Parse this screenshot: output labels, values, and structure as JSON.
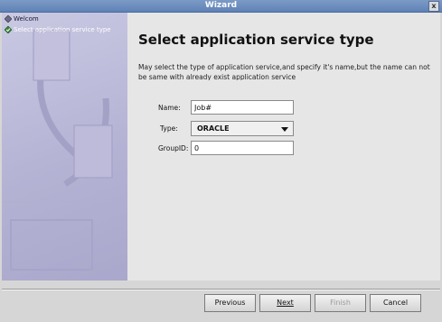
{
  "window": {
    "title": "Wizard",
    "close_glyph": "x"
  },
  "sidebar": {
    "items": [
      {
        "label": "Welcom",
        "icon": "diamond-icon",
        "active": false
      },
      {
        "label": "Select application service type",
        "icon": "checked-diamond-icon",
        "active": true
      }
    ]
  },
  "main": {
    "heading": "Select application service type",
    "description": "May select the type of application service,and specify it's name,but the name can not be same with already exist application service",
    "form": {
      "name": {
        "label": "Name:",
        "value": "Job#"
      },
      "type": {
        "label": "Type:",
        "value": "ORACLE"
      },
      "groupid": {
        "label": "GroupID:",
        "value": "0"
      }
    }
  },
  "buttons": {
    "previous": {
      "label": "Previous",
      "enabled": true
    },
    "next": {
      "label": "Next",
      "enabled": true
    },
    "finish": {
      "label": "Finish",
      "enabled": false
    },
    "cancel": {
      "label": "Cancel",
      "enabled": true
    }
  },
  "colors": {
    "titlebar": "#6a8bbd",
    "sidebar": "#b5b3d4",
    "panel": "#e6e6e6"
  }
}
